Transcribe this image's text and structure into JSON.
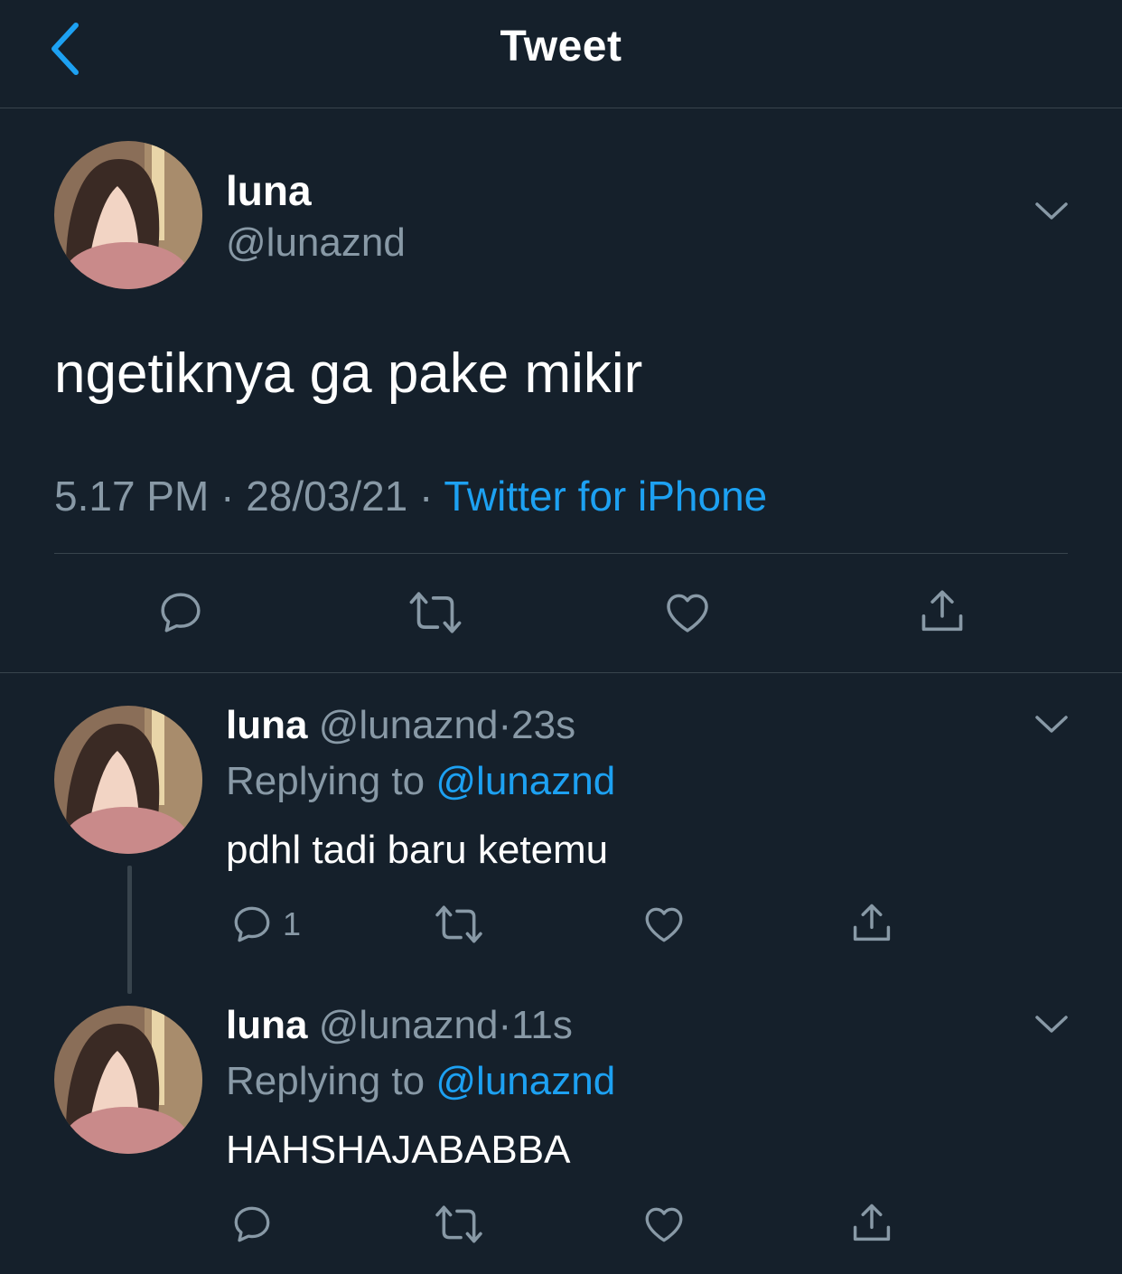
{
  "header": {
    "title": "Tweet",
    "back_icon": "chevron-left-icon"
  },
  "main_tweet": {
    "display_name": "luna",
    "handle": "@lunaznd",
    "text": "ngetiknya ga pake mikir",
    "time": "5.17 PM",
    "sep1": "·",
    "date": "28/03/21",
    "sep2": "·",
    "source": "Twitter for iPhone"
  },
  "replies": [
    {
      "display_name": "luna",
      "handle": "@lunaznd",
      "sep": "·",
      "time": "23s",
      "replying_prefix": "Replying to",
      "replying_handle": "@lunaznd",
      "text": "pdhl tadi baru ketemu",
      "reply_count": "1"
    },
    {
      "display_name": "luna",
      "handle": "@lunaznd",
      "sep": "·",
      "time": "11s",
      "replying_prefix": "Replying to",
      "replying_handle": "@lunaznd",
      "text": "HAHSHAJABABBA",
      "reply_count": ""
    }
  ],
  "colors": {
    "background": "#15202b",
    "muted_text": "#8899a6",
    "link": "#1da1f2",
    "divider": "#38444d"
  }
}
